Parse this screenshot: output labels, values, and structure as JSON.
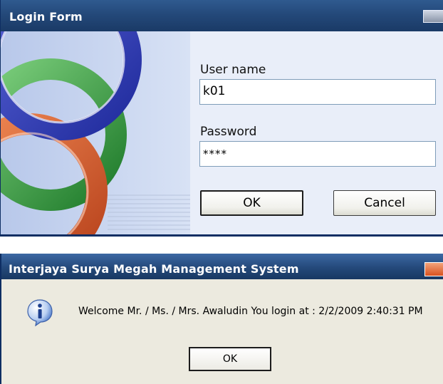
{
  "login_form": {
    "title": "Login Form",
    "username_label": "User name",
    "username_value": "k01",
    "password_label": "Password",
    "password_value": "****",
    "ok_label": "OK",
    "cancel_label": "Cancel"
  },
  "message_box": {
    "title": "Interjaya Surya Megah Management System",
    "message": "Welcome Mr. / Ms. / Mrs. Awaludin You login at : 2/2/2009 2:40:31 PM",
    "ok_label": "OK",
    "icon": "info-icon"
  },
  "colors": {
    "titlebar": "#24497a",
    "window_bg": "#e9eef9",
    "message_bg": "#eceadf"
  }
}
